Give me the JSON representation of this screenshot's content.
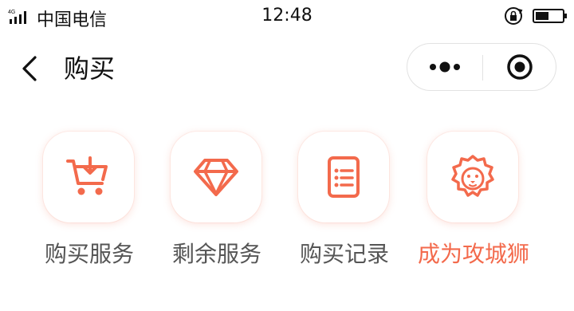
{
  "status_bar": {
    "network_badge": "4G",
    "carrier": "中国电信",
    "time": "12:48"
  },
  "nav": {
    "title": "购买",
    "back_icon": "chevron-left-icon",
    "more_icon": "more-dots-icon",
    "close_icon": "target-close-icon"
  },
  "menu": {
    "items": [
      {
        "label": "购买服务",
        "icon": "cart-download-icon",
        "highlight": false
      },
      {
        "label": "剩余服务",
        "icon": "diamond-icon",
        "highlight": false
      },
      {
        "label": "购买记录",
        "icon": "document-list-icon",
        "highlight": false
      },
      {
        "label": "成为攻城狮",
        "icon": "lion-icon",
        "highlight": true
      }
    ]
  },
  "colors": {
    "accent": "#f36a4c",
    "label": "#555555",
    "tile_shadow": "#f0785a"
  }
}
